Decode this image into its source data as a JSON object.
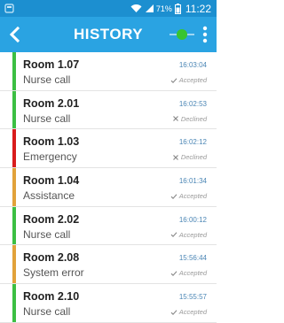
{
  "status_bar": {
    "battery_percent": "71%",
    "time": "11:22"
  },
  "header": {
    "title": "HISTORY",
    "connection_color": "#38c431"
  },
  "colors": {
    "green": "#3cbf43",
    "red": "#d91c1c",
    "amber": "#e2a23a"
  },
  "history": [
    {
      "room": "Room 1.07",
      "type": "Nurse call",
      "time": "16:03:04",
      "status": "Accepted",
      "status_icon": "check-icon",
      "color": "#3cbf43"
    },
    {
      "room": "Room 2.01",
      "type": "Nurse call",
      "time": "16:02:53",
      "status": "Declined",
      "status_icon": "x-icon",
      "color": "#3cbf43"
    },
    {
      "room": "Room 1.03",
      "type": "Emergency",
      "time": "16:02:12",
      "status": "Declined",
      "status_icon": "x-icon",
      "color": "#d91c1c"
    },
    {
      "room": "Room 1.04",
      "type": "Assistance",
      "time": "16:01:34",
      "status": "Accepted",
      "status_icon": "check-icon",
      "color": "#e2a23a"
    },
    {
      "room": "Room 2.02",
      "type": "Nurse call",
      "time": "16:00:12",
      "status": "Accepted",
      "status_icon": "check-icon",
      "color": "#3cbf43"
    },
    {
      "room": "Room 2.08",
      "type": "System error",
      "time": "15:56:44",
      "status": "Accepted",
      "status_icon": "check-icon",
      "color": "#e2a23a"
    },
    {
      "room": "Room 2.10",
      "type": "Nurse call",
      "time": "15:55:57",
      "status": "Accepted",
      "status_icon": "check-icon",
      "color": "#3cbf43"
    }
  ]
}
